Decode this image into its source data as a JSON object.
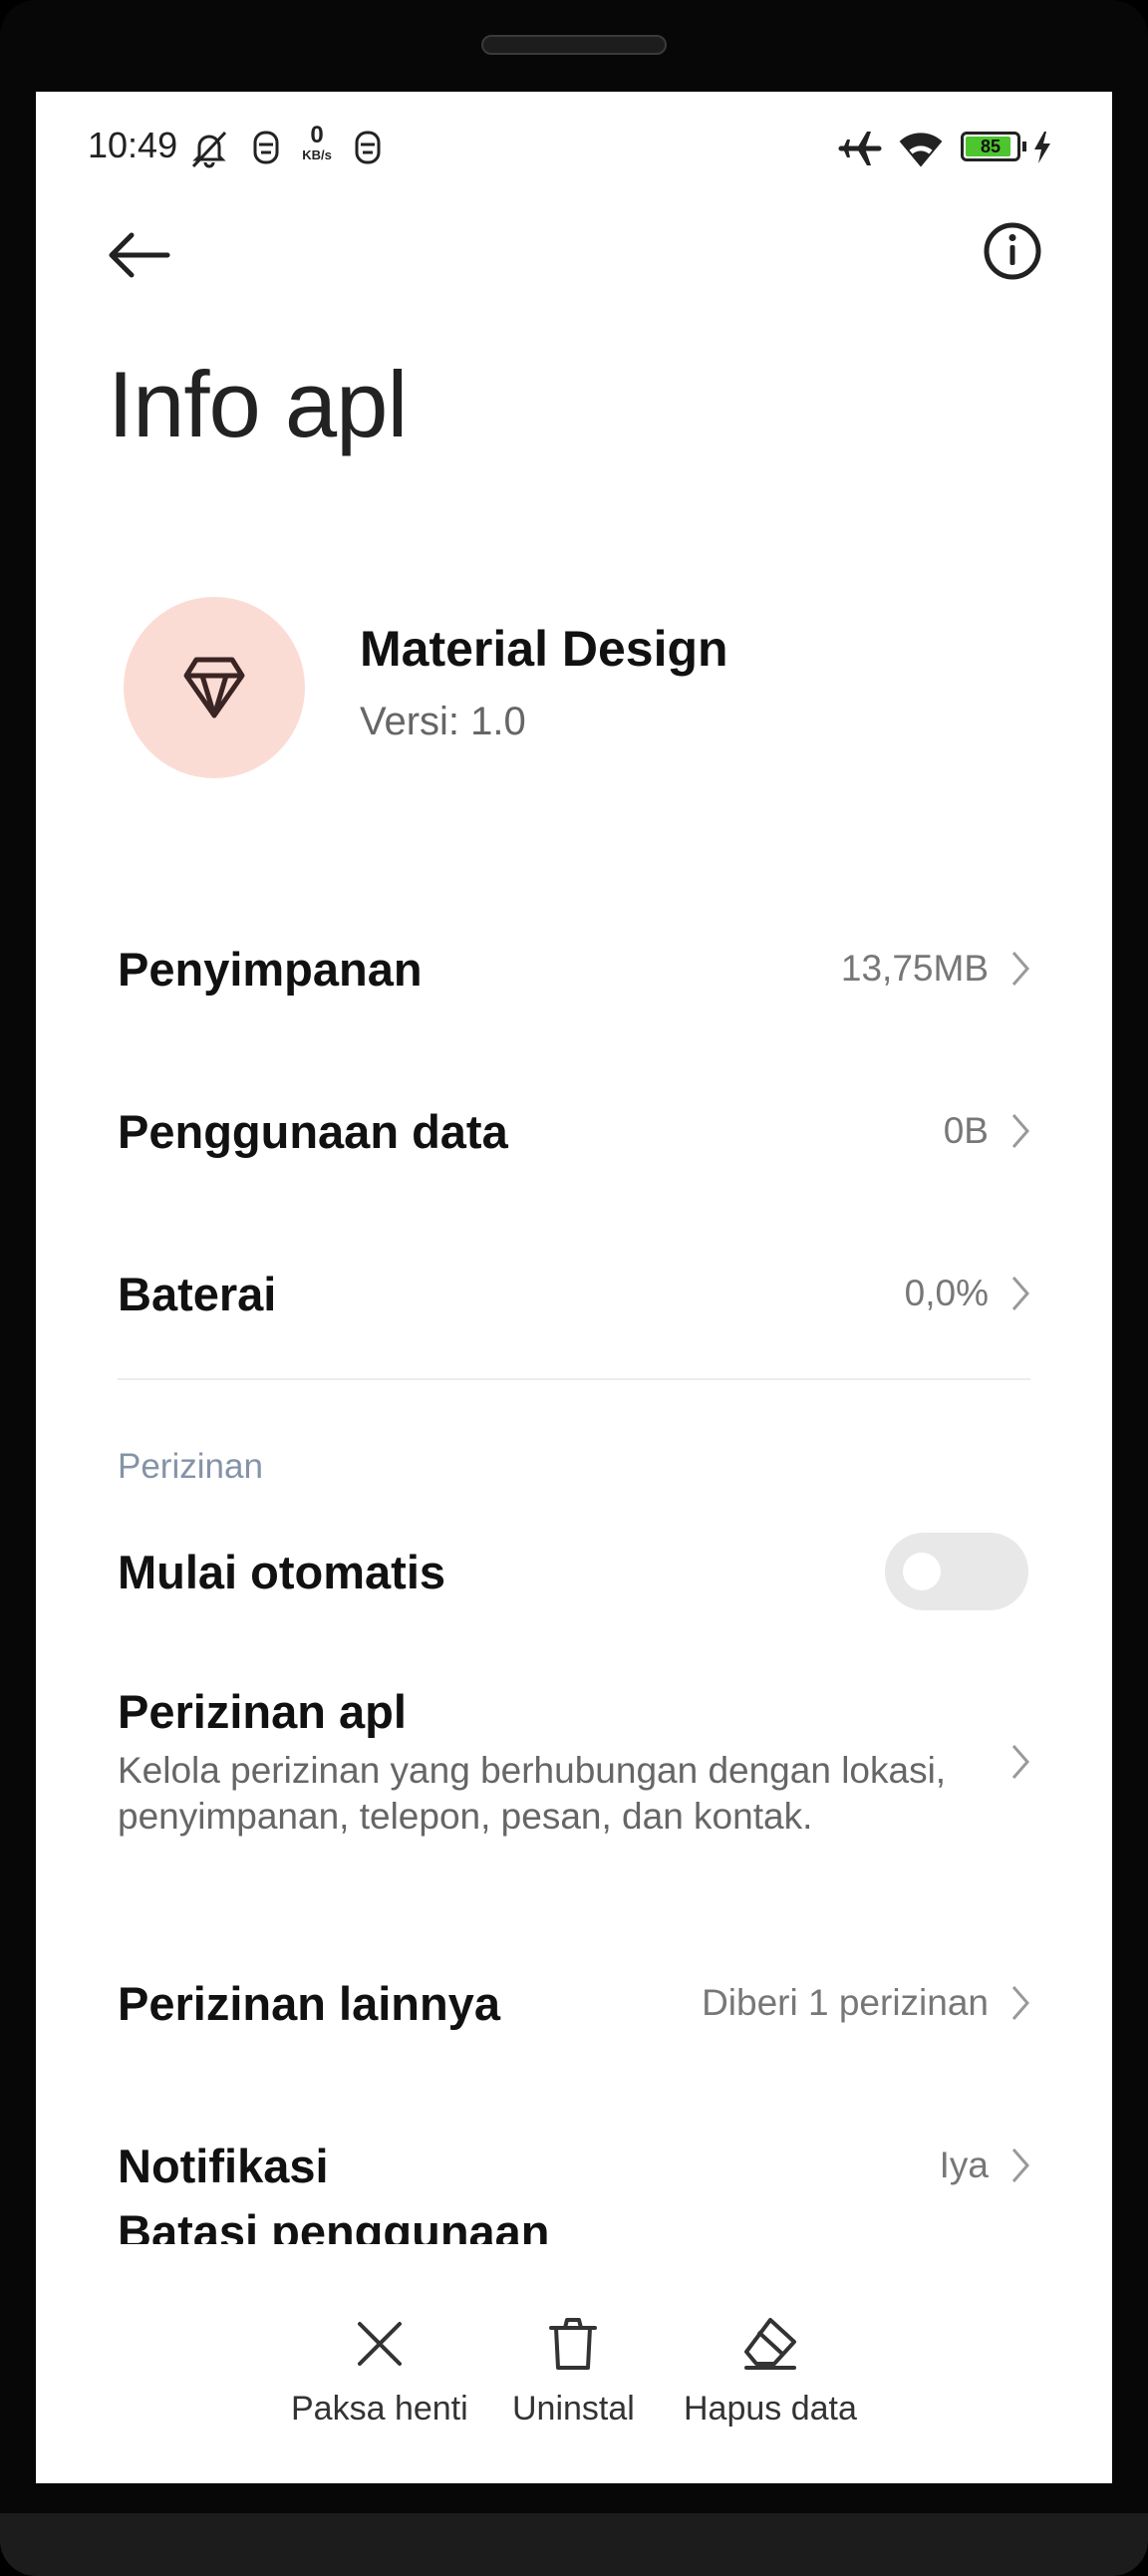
{
  "status_bar": {
    "time": "10:49",
    "speed_value": "0",
    "speed_unit": "KB/s",
    "battery_level": "85"
  },
  "header": {
    "title": "Info apl"
  },
  "app": {
    "name": "Material Design",
    "version": "Versi: 1.0",
    "icon_color": "#fbdcd4"
  },
  "rows": {
    "storage": {
      "label": "Penyimpanan",
      "value": "13,75MB"
    },
    "data_usage": {
      "label": "Penggunaan data",
      "value": "0B"
    },
    "battery": {
      "label": "Baterai",
      "value": "0,0%"
    }
  },
  "permissions": {
    "section_title": "Perizinan",
    "autostart": {
      "label": "Mulai otomatis",
      "enabled": false
    },
    "app_permissions": {
      "label": "Perizinan apl",
      "description": "Kelola perizinan yang berhubungan dengan lokasi, penyimpanan, telepon, pesan, dan kontak."
    },
    "other_permissions": {
      "label": "Perizinan lainnya",
      "value": "Diberi 1 perizinan"
    },
    "notifications": {
      "label": "Notifikasi",
      "value": "Iya"
    },
    "restrict_usage": {
      "label": "Batasi penggunaan"
    }
  },
  "actions": {
    "force_stop": "Paksa henti",
    "uninstall": "Uninstal",
    "clear_data": "Hapus data"
  }
}
